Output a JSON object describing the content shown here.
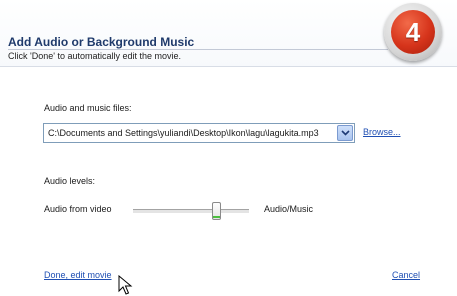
{
  "header": {
    "title": "Add Audio or Background Music",
    "subtitle": "Click 'Done' to automatically edit the movie.",
    "step_number": "4"
  },
  "audio_files": {
    "label": "Audio and music files:",
    "selected_file": "C:\\Documents and Settings\\yuliandi\\Desktop\\Ikon\\lagu\\lagukita.mp3",
    "browse_label": "Browse..."
  },
  "audio_levels": {
    "label": "Audio levels:",
    "left_label": "Audio from video",
    "right_label": "Audio/Music",
    "balance_fraction": 0.72
  },
  "footer": {
    "done_label": "Done, edit movie",
    "cancel_label": "Cancel"
  },
  "colors": {
    "title": "#1f3a6b",
    "link": "#1f4fb3",
    "badge": "#d6341b",
    "slider_indicator": "#4cbf3f"
  },
  "icons": {
    "select_arrow": "chevron-down-icon",
    "cursor": "mouse-pointer-icon"
  }
}
